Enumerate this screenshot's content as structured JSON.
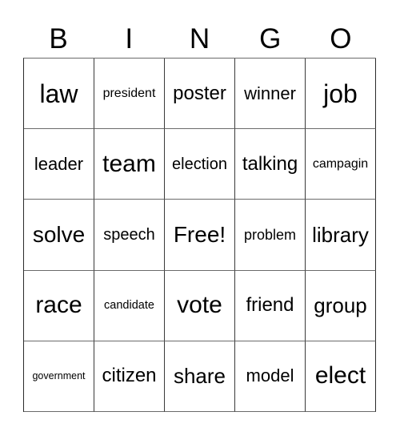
{
  "header": {
    "letters": [
      "B",
      "I",
      "N",
      "G",
      "O"
    ]
  },
  "card": {
    "rows": [
      [
        "law",
        "president",
        "poster",
        "winner",
        "job"
      ],
      [
        "leader",
        "team",
        "election",
        "talking",
        "campagin"
      ],
      [
        "solve",
        "speech",
        "Free!",
        "problem",
        "library"
      ],
      [
        "race",
        "candidate",
        "vote",
        "friend",
        "group"
      ],
      [
        "government",
        "citizen",
        "share",
        "model",
        "elect"
      ]
    ],
    "free_space": {
      "row": 2,
      "col": 2,
      "label": "Free!"
    }
  }
}
